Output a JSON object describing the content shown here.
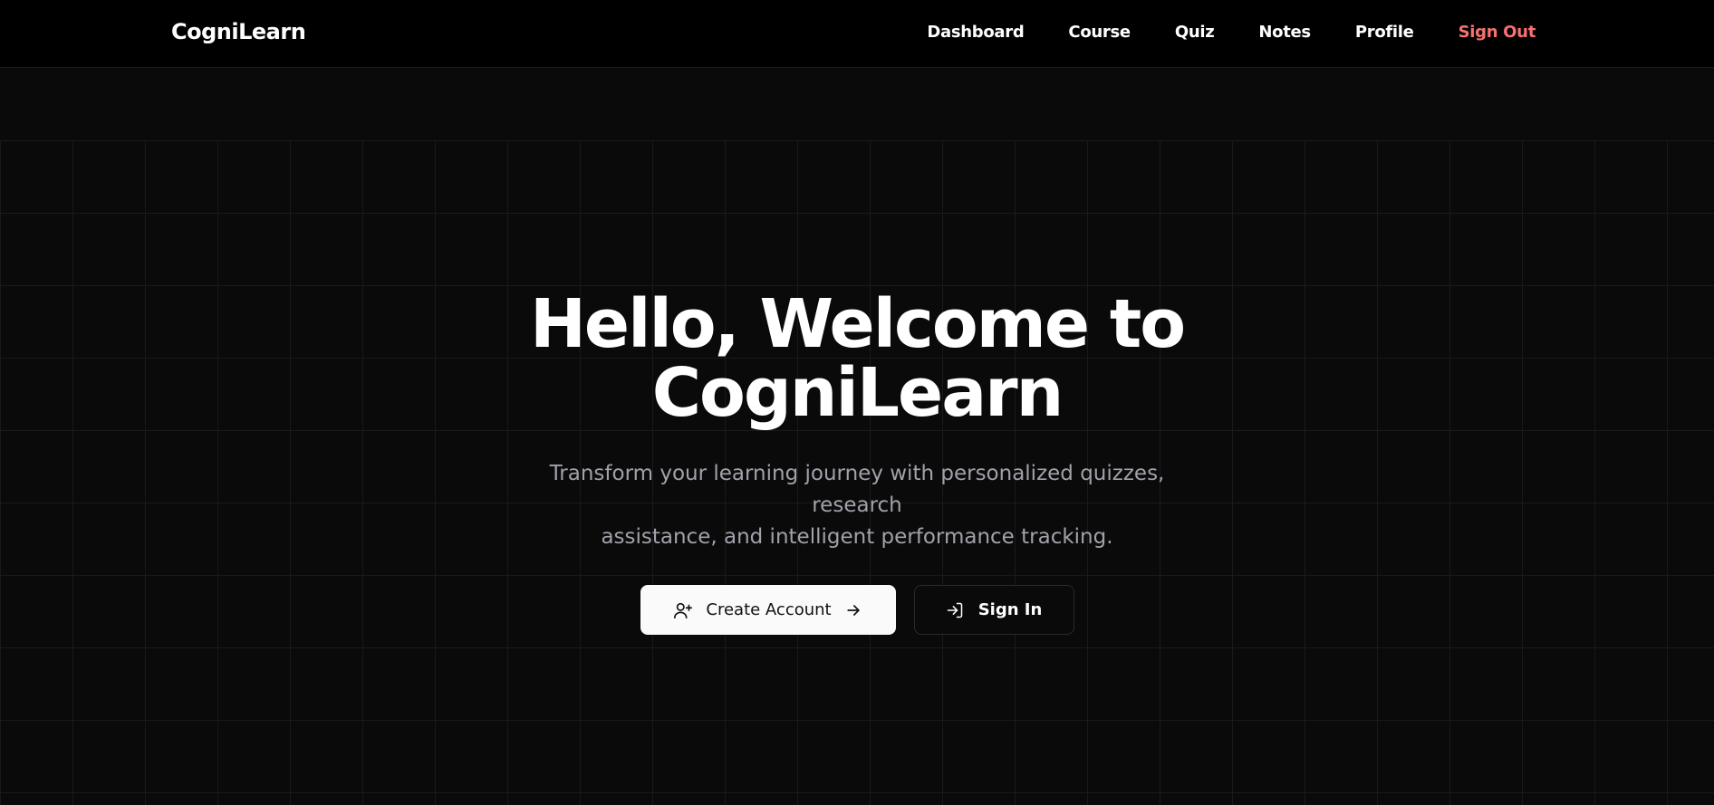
{
  "header": {
    "brand": "CogniLearn",
    "nav": [
      {
        "label": "Dashboard"
      },
      {
        "label": "Course"
      },
      {
        "label": "Quiz"
      },
      {
        "label": "Notes"
      },
      {
        "label": "Profile"
      },
      {
        "label": "Sign Out"
      }
    ]
  },
  "hero": {
    "headline_line1": "Hello, Welcome to",
    "headline_line2": "CogniLearn",
    "subtitle_line1": "Transform your learning journey with personalized quizzes, research",
    "subtitle_line2": "assistance, and intelligent performance tracking.",
    "primary_button": {
      "label": "Create Account",
      "icon": "user-plus-icon",
      "trailing_icon": "arrow-right-icon"
    },
    "secondary_button": {
      "label": "Sign In",
      "icon": "log-in-icon"
    }
  },
  "colors": {
    "background": "#0a0a0b",
    "header_background": "#000000",
    "sign_out": "#f87171",
    "subtitle": "#a1a1aa",
    "primary_button": "#fafafa"
  }
}
